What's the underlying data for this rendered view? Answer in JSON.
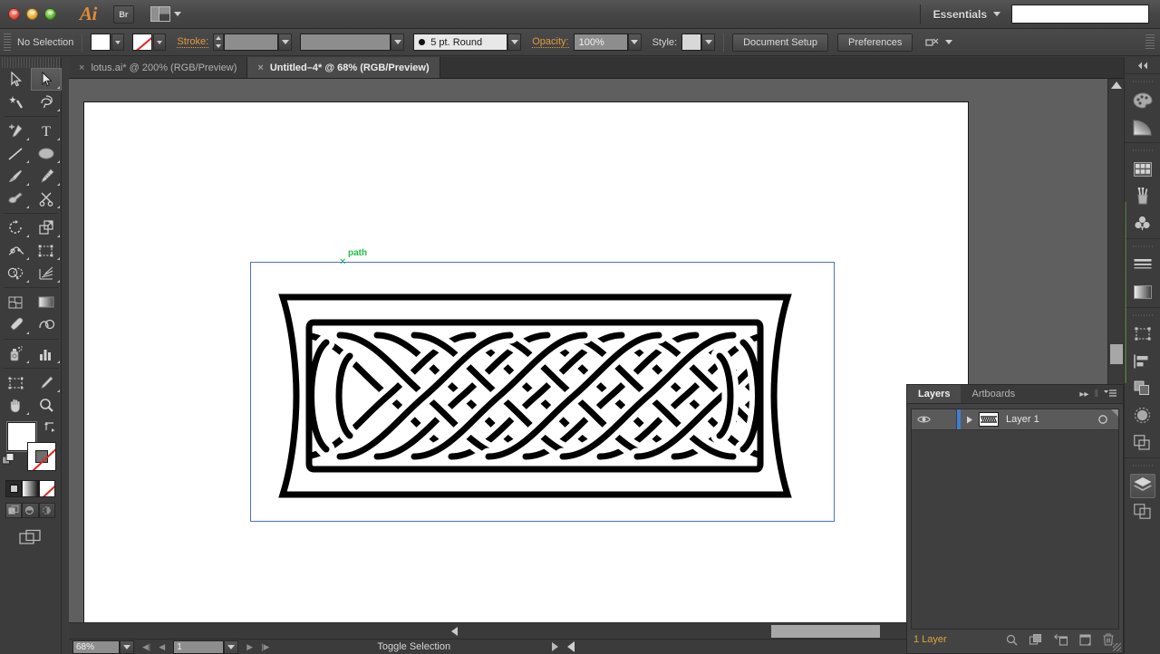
{
  "app": {
    "name": "Ai",
    "titlebar": {
      "bridge_button": "Br",
      "arrange_icon": "arrange-documents-icon",
      "workspace": "Essentials",
      "search_value": "",
      "search_placeholder": ""
    }
  },
  "control_bar": {
    "selection_status": "No Selection",
    "fill_swatch_color": "#ffffff",
    "stroke_swatch": "none",
    "stroke_label": "Stroke:",
    "stroke_weight": "",
    "stroke_profile": "",
    "brush_definition": "5 pt. Round",
    "opacity_label": "Opacity:",
    "opacity_value": "100%",
    "style_label": "Style:",
    "document_setup_button": "Document Setup",
    "preferences_button": "Preferences"
  },
  "tabs": [
    {
      "label": "lotus.ai* @ 200% (RGB/Preview)",
      "active": false,
      "close": "×"
    },
    {
      "label": "Untitled–4* @ 68% (RGB/Preview)",
      "active": true,
      "close": "×"
    }
  ],
  "toolbar": {
    "tools": [
      {
        "name": "selection-tool",
        "selected": false
      },
      {
        "name": "direct-selection-tool",
        "selected": true
      },
      {
        "name": "magic-wand-tool",
        "selected": false
      },
      {
        "name": "lasso-tool",
        "selected": false
      },
      {
        "name": "pen-tool",
        "selected": false
      },
      {
        "name": "type-tool",
        "selected": false
      },
      {
        "name": "line-segment-tool",
        "selected": false
      },
      {
        "name": "ellipse-tool",
        "selected": false
      },
      {
        "name": "paintbrush-tool",
        "selected": false
      },
      {
        "name": "pencil-tool",
        "selected": false
      },
      {
        "name": "blob-brush-tool",
        "selected": false
      },
      {
        "name": "scissors-tool",
        "selected": false
      },
      {
        "name": "rotate-tool",
        "selected": false
      },
      {
        "name": "scale-tool",
        "selected": false
      },
      {
        "name": "width-tool",
        "selected": false
      },
      {
        "name": "free-transform-tool",
        "selected": false
      },
      {
        "name": "shape-builder-tool",
        "selected": false
      },
      {
        "name": "perspective-grid-tool",
        "selected": false
      },
      {
        "name": "mesh-tool",
        "selected": false
      },
      {
        "name": "gradient-tool",
        "selected": false
      },
      {
        "name": "eyedropper-tool",
        "selected": false
      },
      {
        "name": "blend-tool",
        "selected": false
      },
      {
        "name": "symbol-sprayer-tool",
        "selected": false
      },
      {
        "name": "column-graph-tool",
        "selected": false
      },
      {
        "name": "artboard-tool",
        "selected": false
      },
      {
        "name": "slice-tool",
        "selected": false
      },
      {
        "name": "hand-tool",
        "selected": false
      },
      {
        "name": "zoom-tool",
        "selected": false
      }
    ],
    "fill_color": "#ffffff",
    "stroke_color": "none",
    "paint_modes": [
      "color",
      "gradient",
      "none"
    ],
    "drawing_modes": [
      "draw-normal",
      "draw-behind",
      "draw-inside"
    ],
    "screen_mode": "screen-mode-icon"
  },
  "canvas": {
    "artboard_background": "#ffffff",
    "canvas_background": "#5f5f5f",
    "selection_color": "#4a72d4",
    "smart_guide_label": "path",
    "smart_guide_color": "#1fc04a",
    "artwork_name": "celtic-knot-border",
    "artwork_stroke_color": "#000000"
  },
  "status_bar": {
    "zoom_value": "68%",
    "page_value": "1",
    "status_text": "Toggle Selection"
  },
  "layers_panel": {
    "tabs": [
      {
        "label": "Layers",
        "active": true
      },
      {
        "label": "Artboards",
        "active": false
      }
    ],
    "header_icons": [
      "expand-panel-icon",
      "panel-menu-icon"
    ],
    "layers": [
      {
        "name": "Layer 1",
        "visible": true,
        "locked": false,
        "selected": true,
        "color": "#3d7fd4"
      }
    ],
    "footer_count": "1 Layer",
    "footer_icons": [
      "locate-object-icon",
      "make-clipping-mask-icon",
      "create-new-sublayer-icon",
      "create-new-layer-icon",
      "delete-selection-icon"
    ]
  },
  "right_dock": {
    "collapse_icon": "collapse-to-icons-icon",
    "groups": [
      {
        "items": [
          "color-panel-icon",
          "color-guide-panel-icon"
        ]
      },
      {
        "items": [
          "swatches-panel-icon",
          "brushes-panel-icon",
          "symbols-panel-icon"
        ]
      },
      {
        "items": [
          "stroke-panel-icon",
          "gradient-panel-icon"
        ]
      },
      {
        "items": [
          "transform-panel-icon",
          "align-panel-icon",
          "pathfinder-panel-icon",
          "transparency-panel-icon",
          "appearance-panel-icon"
        ]
      },
      {
        "items": [
          "layers-panel-icon",
          "artboards-panel-icon"
        ]
      }
    ],
    "active_item": "layers-panel-icon"
  }
}
